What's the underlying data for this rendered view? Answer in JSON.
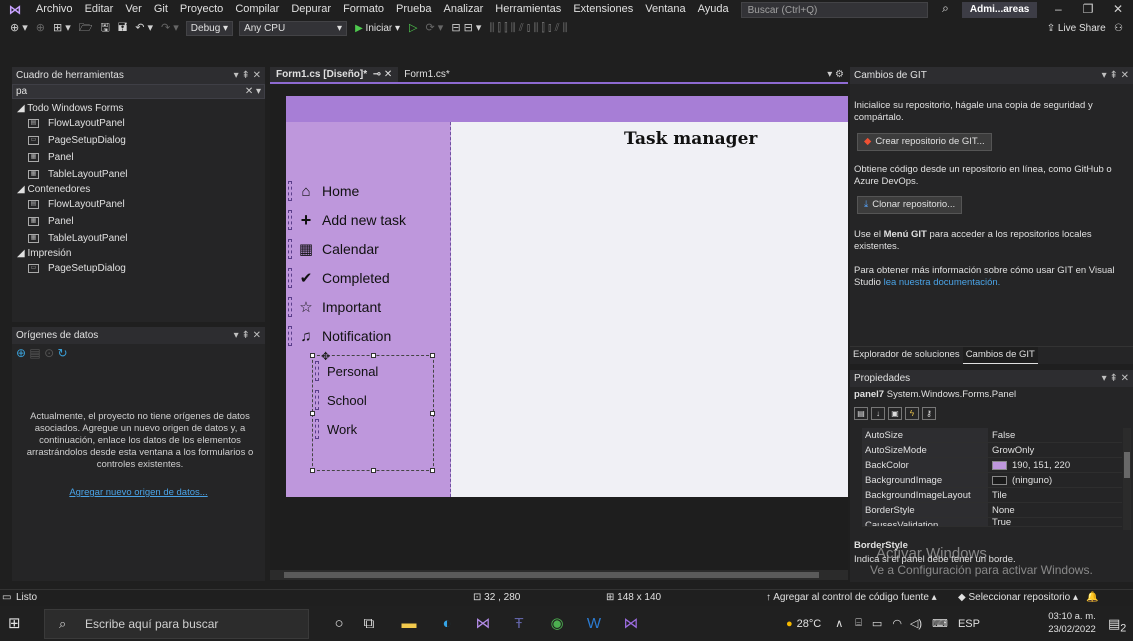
{
  "menubar": {
    "items": [
      "Archivo",
      "Editar",
      "Ver",
      "Git",
      "Proyecto",
      "Compilar",
      "Depurar",
      "Formato",
      "Prueba",
      "Analizar",
      "Herramientas",
      "Extensiones",
      "Ventana",
      "Ayuda"
    ],
    "search_placeholder": "Buscar (Ctrl+Q)",
    "user": "Admi...areas"
  },
  "toolbar": {
    "config": "Debug",
    "platform": "Any CPU",
    "start_label": "Iniciar",
    "live_share": "Live Share"
  },
  "toolbox": {
    "title": "Cuadro de herramientas",
    "search_value": "pa",
    "groups": [
      {
        "label": "Todo Windows Forms",
        "items": [
          "FlowLayoutPanel",
          "PageSetupDialog",
          "Panel",
          "TableLayoutPanel"
        ]
      },
      {
        "label": "Contenedores",
        "items": [
          "FlowLayoutPanel",
          "Panel",
          "TableLayoutPanel"
        ]
      },
      {
        "label": "Impresión",
        "items": [
          "PageSetupDialog"
        ]
      }
    ]
  },
  "datasources": {
    "title": "Orígenes de datos",
    "message": "Actualmente, el proyecto no tiene orígenes de datos asociados. Agregue un nuevo origen de datos y, a continuación, enlace los datos de los elementos arrastrándolos desde esta ventana a los formularios o controles existentes.",
    "link": "Agregar nuevo origen de datos..."
  },
  "doc_tabs": [
    {
      "label": "Form1.cs [Diseño]*",
      "active": true
    },
    {
      "label": "Form1.cs*",
      "active": false
    }
  ],
  "form": {
    "app_title": "Task manager",
    "nav_items": [
      {
        "icon": "home-icon",
        "glyph": "🏠",
        "label": "Home"
      },
      {
        "icon": "plus-icon",
        "glyph": "✚",
        "label": "Add new task"
      },
      {
        "icon": "calendar-icon",
        "glyph": "📅",
        "label": "Calendar"
      },
      {
        "icon": "check-icon",
        "glyph": "✔",
        "label": "Completed"
      },
      {
        "icon": "star-icon",
        "glyph": "☆",
        "label": "Important"
      },
      {
        "icon": "bell-icon",
        "glyph": "🔔",
        "label": "Notification"
      }
    ],
    "sub_items": [
      "Personal",
      "School",
      "Work"
    ],
    "colors": {
      "title_bar": "#a77ed6",
      "sidebar": "#be97dc"
    }
  },
  "git": {
    "title": "Cambios de GIT",
    "init_text": "Inicialice su repositorio, hágale una copia de seguridad y compártalo.",
    "create_btn": "Crear repositorio de GIT...",
    "clone_text": "Obtiene código desde un repositorio en línea, como GitHub o Azure DevOps.",
    "clone_btn": "Clonar repositorio...",
    "menu_text_pre": "Use el ",
    "menu_text_bold": "Menú GIT",
    "menu_text_post": " para acceder a los repositorios locales existentes.",
    "more_text": "Para obtener más información sobre cómo usar GIT en Visual Studio ",
    "more_link": "lea nuestra documentación."
  },
  "right_tabs": [
    "Explorador de soluciones",
    "Cambios de GIT"
  ],
  "properties": {
    "title": "Propiedades",
    "object_name": "panel7",
    "object_type": "System.Windows.Forms.Panel",
    "rows": [
      {
        "key": "AutoSize",
        "value": "False"
      },
      {
        "key": "AutoSizeMode",
        "value": "GrowOnly"
      },
      {
        "key": "BackColor",
        "value": "190, 151, 220",
        "swatch": "#be97dc"
      },
      {
        "key": "BackgroundImage",
        "value": "(ninguno)",
        "swatch": "#1a1a1a"
      },
      {
        "key": "BackgroundImageLayout",
        "value": "Tile"
      },
      {
        "key": "BorderStyle",
        "value": "None"
      },
      {
        "key": "CausesValidation",
        "value": "True"
      }
    ],
    "desc_name": "BorderStyle",
    "desc_text": "Indica si el panel debe tener un borde."
  },
  "watermark": {
    "line1": "Activar Windows",
    "line2": "Ve a Configuración para activar Windows."
  },
  "status": {
    "ready": "Listo",
    "position": "32 , 280",
    "size": "148 x 140",
    "add_source": "Agregar al control de código fuente",
    "select_repo": "Seleccionar repositorio"
  },
  "taskbar": {
    "search_placeholder": "Escribe aquí para buscar",
    "weather": "28°C",
    "lang": "ESP",
    "time": "03:10 a. m.",
    "date": "23/02/2022",
    "notif_count": "2"
  }
}
